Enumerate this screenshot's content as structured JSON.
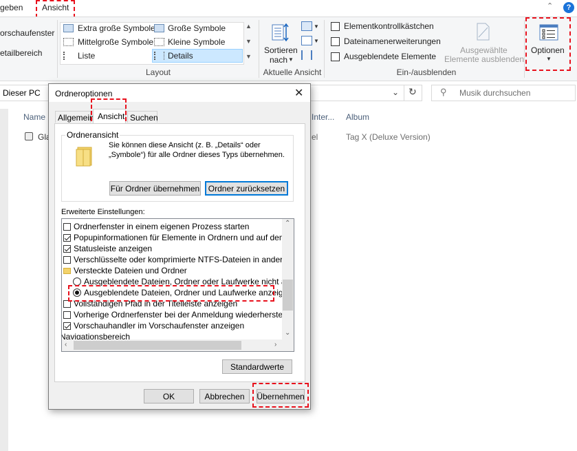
{
  "tabs": {
    "partial_left": "geben",
    "view": "Ansicht"
  },
  "ribbon": {
    "left_items": [
      "orschaufenster",
      "etailbereich"
    ],
    "layout_options": [
      [
        "Extra große Symbole",
        "Große Symbole"
      ],
      [
        "Mittelgroße Symbole",
        "Kleine Symbole"
      ],
      [
        "Liste",
        "Details"
      ]
    ],
    "layout_label": "Layout",
    "sort_label_1": "Sortieren",
    "sort_label_2": "nach",
    "current_view_label": "Aktuelle Ansicht",
    "checkboxes": [
      "Elementkontrollkästchen",
      "Dateinamenerweiterungen",
      "Ausgeblendete Elemente"
    ],
    "hide_selected_1": "Ausgewählte",
    "hide_selected_2": "Elemente ausblenden",
    "show_hide_label": "Ein-/ausblenden",
    "options_label": "Optionen"
  },
  "address": {
    "path": "Dieser PC",
    "search_placeholder": "Musik durchsuchen"
  },
  "file_list": {
    "col_name": "Name",
    "col_inter": "Inter...",
    "col_album": "Album",
    "row_name": "Gla",
    "row_inter": "el",
    "row_album": "Tag X (Deluxe Version)"
  },
  "dialog": {
    "title": "Ordneroptionen",
    "tabs": [
      "Allgemein",
      "Ansicht",
      "Suchen"
    ],
    "folder_view_title": "Ordneransicht",
    "folder_view_desc_1": "Sie können diese Ansicht (z. B. „Details“ oder",
    "folder_view_desc_2": "„Symbole“) für alle Ordner dieses Typs übernehmen.",
    "apply_folders": "Für Ordner übernehmen",
    "reset_folders": "Ordner zurücksetzen",
    "advanced_label": "Erweiterte Einstellungen:",
    "settings": [
      "Ordnerfenster in einem eigenen Prozess starten",
      "Popupinformationen für Elemente in Ordnern und auf dem Desktop",
      "Statusleiste anzeigen",
      "Verschlüsselte oder komprimierte NTFS-Dateien in anderer Farbe",
      "Versteckte Dateien und Ordner",
      "Ausgeblendete Dateien, Ordner oder Laufwerke nicht anzeigen",
      "Ausgeblendete Dateien, Ordner und Laufwerke anzeigen",
      "Vollständigen Pfad in der Titelleiste anzeigen",
      "Vorherige Ordnerfenster bei der Anmeldung wiederherstellen",
      "Vorschauhandler im Vorschaufenster anzeigen",
      "Navigationsbereich"
    ],
    "defaults": "Standardwerte",
    "ok": "OK",
    "cancel": "Abbrechen",
    "apply": "Übernehmen"
  },
  "colors": {
    "highlight": "#e8101c",
    "accent": "#0078d7"
  }
}
